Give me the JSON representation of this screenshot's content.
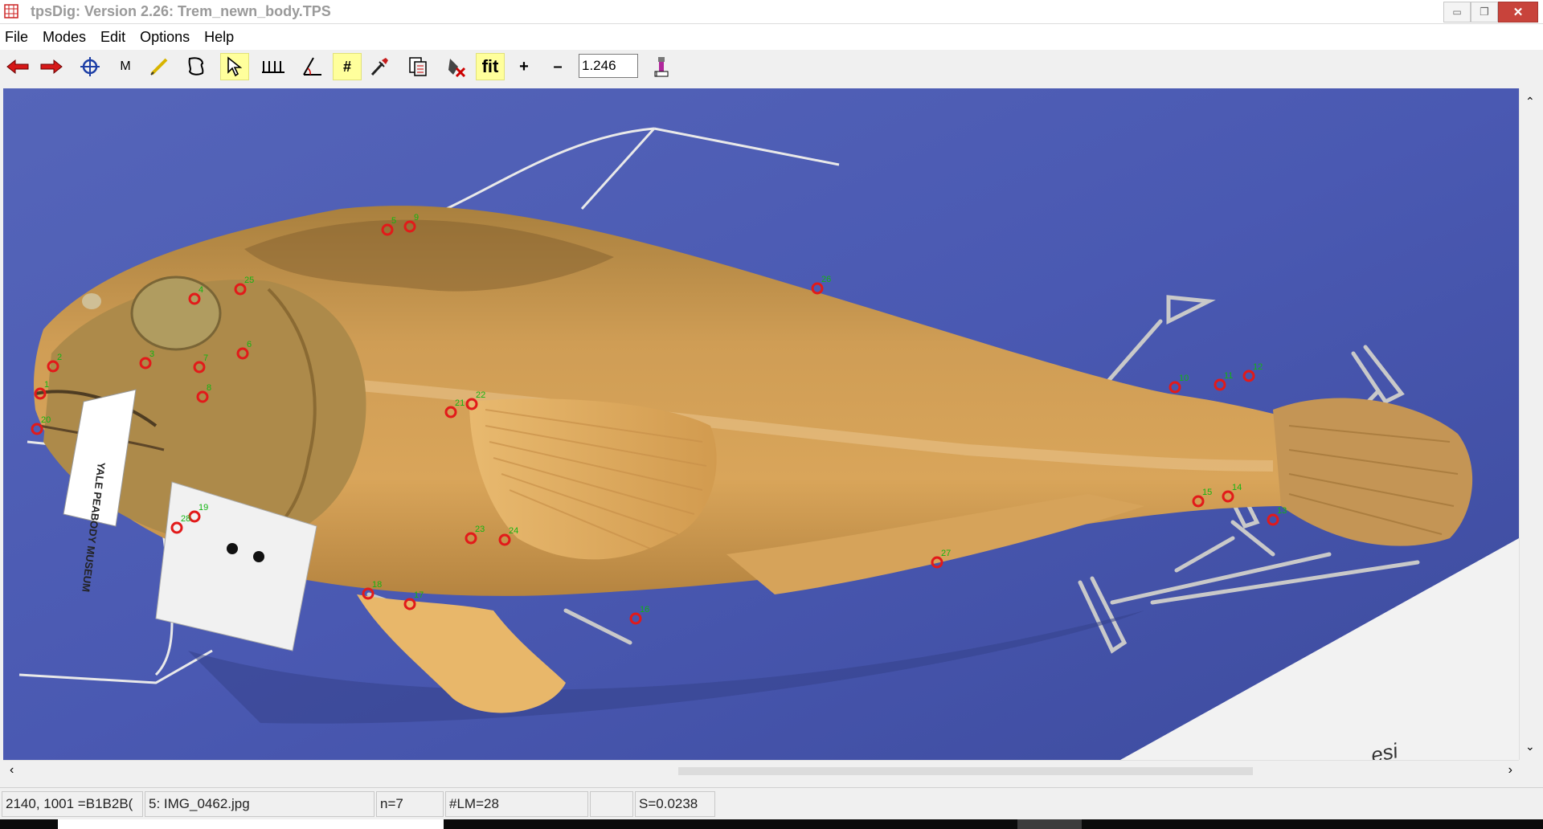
{
  "window": {
    "title": "tpsDig: Version 2.26: Trem_newn_body.TPS",
    "minimize_glyph": "▭",
    "maximize_glyph": "❐",
    "close_glyph": "✕"
  },
  "menu": [
    "File",
    "Modes",
    "Edit",
    "Options",
    "Help"
  ],
  "toolbar": {
    "back_icon": "red-left-arrow",
    "forward_icon": "red-right-arrow",
    "m_label": "M",
    "hash_label": "#",
    "fit_label": "fit",
    "plus_label": "+",
    "minus_label": "–",
    "zoom_value": "1.246"
  },
  "image": {
    "tag_text": "YALE PEABODY MUSEUM",
    "corner_text": "esi",
    "landmarks": [
      {
        "n": "1"
      },
      {
        "n": "2"
      },
      {
        "n": "3"
      },
      {
        "n": "4"
      },
      {
        "n": "5"
      },
      {
        "n": "6"
      },
      {
        "n": "7"
      },
      {
        "n": "8"
      },
      {
        "n": "9"
      },
      {
        "n": "10"
      },
      {
        "n": "11"
      },
      {
        "n": "12"
      },
      {
        "n": "13"
      },
      {
        "n": "14"
      },
      {
        "n": "15"
      },
      {
        "n": "16"
      },
      {
        "n": "17"
      },
      {
        "n": "18"
      },
      {
        "n": "19"
      },
      {
        "n": "20"
      },
      {
        "n": "21"
      },
      {
        "n": "22"
      },
      {
        "n": "23"
      },
      {
        "n": "24"
      },
      {
        "n": "25"
      },
      {
        "n": "26"
      },
      {
        "n": "27"
      },
      {
        "n": "28"
      }
    ]
  },
  "status": {
    "coords": "2140, 1001 =B1B2B(",
    "file": "5: IMG_0462.jpg",
    "n": "n=7",
    "lm": "#LM=28",
    "empty": "",
    "scale": "S=0.0238"
  },
  "colors": {
    "background_blue": "#4f5fb7",
    "landmark_red": "#e21a1a",
    "landmark_label_green": "#11b511",
    "active_tool": "#ffff9c"
  }
}
